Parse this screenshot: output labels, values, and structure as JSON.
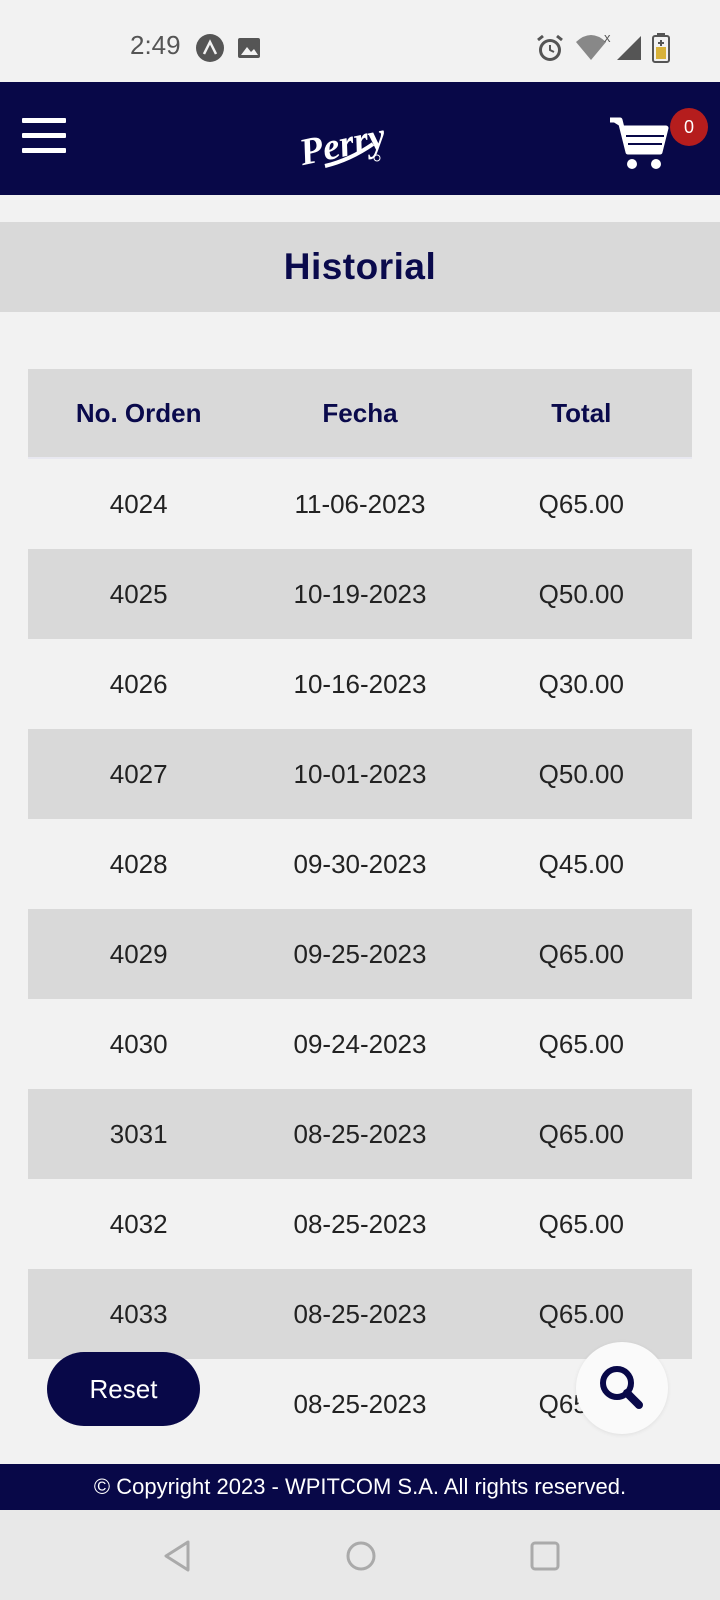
{
  "status_bar": {
    "time": "2:49",
    "icons": [
      "app-notification-icon",
      "image-icon",
      "alarm-icon",
      "wifi-icon",
      "signal-icon",
      "battery-icon"
    ]
  },
  "header": {
    "menu_icon": "hamburger-menu-icon",
    "logo_text": "Perry",
    "cart_icon": "shopping-cart-icon",
    "cart_count": "0",
    "colors": {
      "background": "#080848",
      "badge": "#b51d1d"
    }
  },
  "page": {
    "title": "Historial"
  },
  "table": {
    "columns": [
      "No. Orden",
      "Fecha",
      "Total"
    ],
    "rows": [
      [
        "4024",
        "11-06-2023",
        "Q65.00"
      ],
      [
        "4025",
        "10-19-2023",
        "Q50.00"
      ],
      [
        "4026",
        "10-16-2023",
        "Q30.00"
      ],
      [
        "4027",
        "10-01-2023",
        "Q50.00"
      ],
      [
        "4028",
        "09-30-2023",
        "Q45.00"
      ],
      [
        "4029",
        "09-25-2023",
        "Q65.00"
      ],
      [
        "4030",
        "09-24-2023",
        "Q65.00"
      ],
      [
        "3031",
        "08-25-2023",
        "Q65.00"
      ],
      [
        "4032",
        "08-25-2023",
        "Q65.00"
      ],
      [
        "4033",
        "08-25-2023",
        "Q65.00"
      ],
      [
        "",
        "08-25-2023",
        "Q65.00"
      ]
    ]
  },
  "actions": {
    "reset_label": "Reset",
    "search_icon": "search-icon"
  },
  "footer": {
    "copyright": "© Copyright 2023 - WPITCOM S.A. All rights reserved."
  },
  "nav_bar": {
    "icons": [
      "back-icon",
      "home-icon",
      "recents-icon"
    ]
  }
}
